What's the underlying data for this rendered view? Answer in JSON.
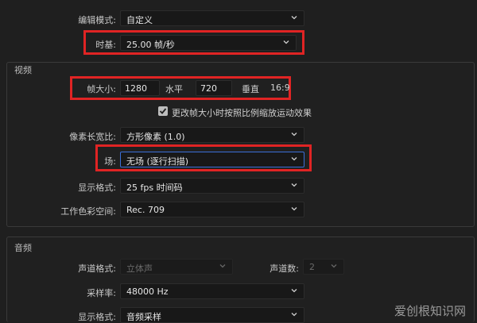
{
  "top": {
    "edit_mode_label": "编辑模式:",
    "edit_mode_value": "自定义",
    "timebase_label": "时基:",
    "timebase_value": "25.00  帧/秒"
  },
  "video": {
    "section_title": "视频",
    "frame_size_label": "帧大小:",
    "width_value": "1280",
    "horizontal_label": "水平",
    "height_value": "720",
    "vertical_label": "垂直",
    "aspect_ratio": "16:9",
    "scale_checkbox_label": "更改帧大小时按照比例缩放运动效果",
    "scale_checkbox_checked": true,
    "pixel_aspect_label": "像素长宽比:",
    "pixel_aspect_value": "方形像素 (1.0)",
    "fields_label": "场:",
    "fields_value": "无场 (逐行扫描)",
    "display_format_label": "显示格式:",
    "display_format_value": "25 fps 时间码",
    "color_space_label": "工作色彩空间:",
    "color_space_value": "Rec. 709"
  },
  "audio": {
    "section_title": "音频",
    "channel_format_label": "声道格式:",
    "channel_format_value": "立体声",
    "channel_count_label": "声道数:",
    "channel_count_value": "2",
    "sample_rate_label": "采样率:",
    "sample_rate_value": "48000 Hz",
    "display_format_label": "显示格式:",
    "display_format_value": "音频采样"
  },
  "watermark": "爱创根知识网",
  "colors": {
    "highlight": "#e02424",
    "background": "#1f1f1f"
  }
}
